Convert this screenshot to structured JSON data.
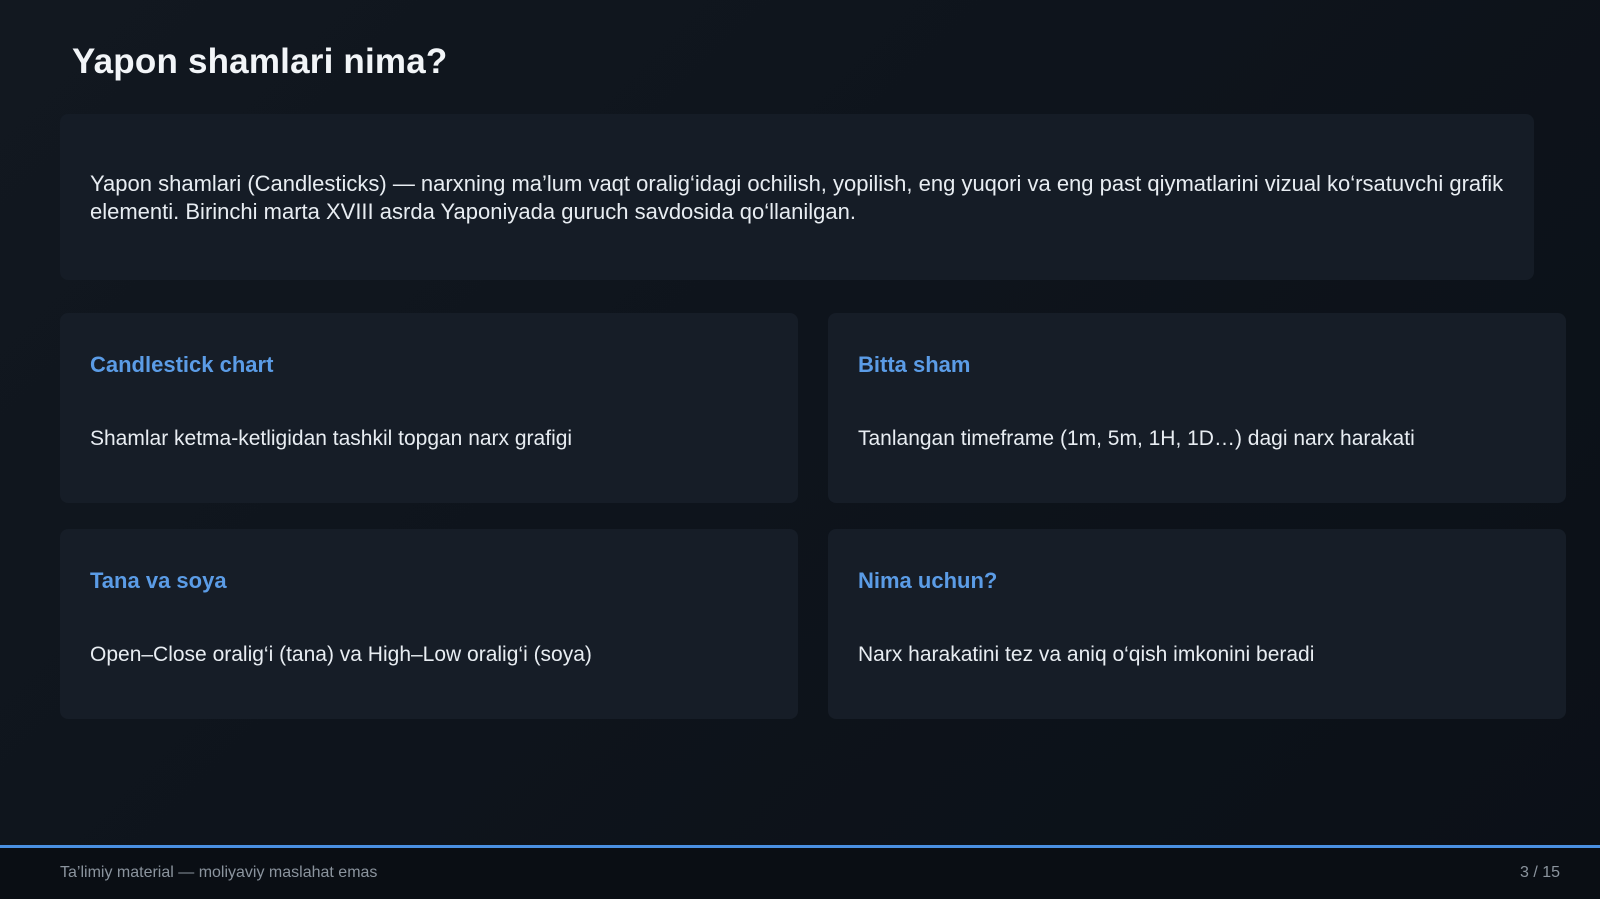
{
  "slide": {
    "title": "Yapon shamlari nima?",
    "intro": "Yapon shamlari (Candlesticks) — narxning ma’lum vaqt oralig‘idagi ochilish, yopilish, eng yuqori va eng past qiymatlarini vizual ko‘rsatuvchi grafik elementi. Birinchi marta XVIII asrda Yaponiyada guruch savdosida qo‘llanilgan.",
    "cards": [
      {
        "title": "Candlestick chart",
        "text": "Shamlar ketma-ketligidan tashkil topgan narx grafigi"
      },
      {
        "title": "Bitta sham",
        "text": "Tanlangan timeframe (1m, 5m, 1H, 1D…) dagi narx harakati"
      },
      {
        "title": "Tana va soya",
        "text": "Open–Close oralig‘i (tana) va High–Low oralig‘i (soya)"
      },
      {
        "title": "Nima uchun?",
        "text": "Narx harakatini tez va aniq o‘qish imkonini beradi"
      }
    ]
  },
  "footer": {
    "disclaimer": "Ta’limiy material — moliyaviy maslahat emas",
    "page_indicator": "3 / 15"
  },
  "colors": {
    "background": "#0d1117",
    "card": "#161d27",
    "accent": "#5b9ce6",
    "footer_line": "#4a90e2"
  }
}
